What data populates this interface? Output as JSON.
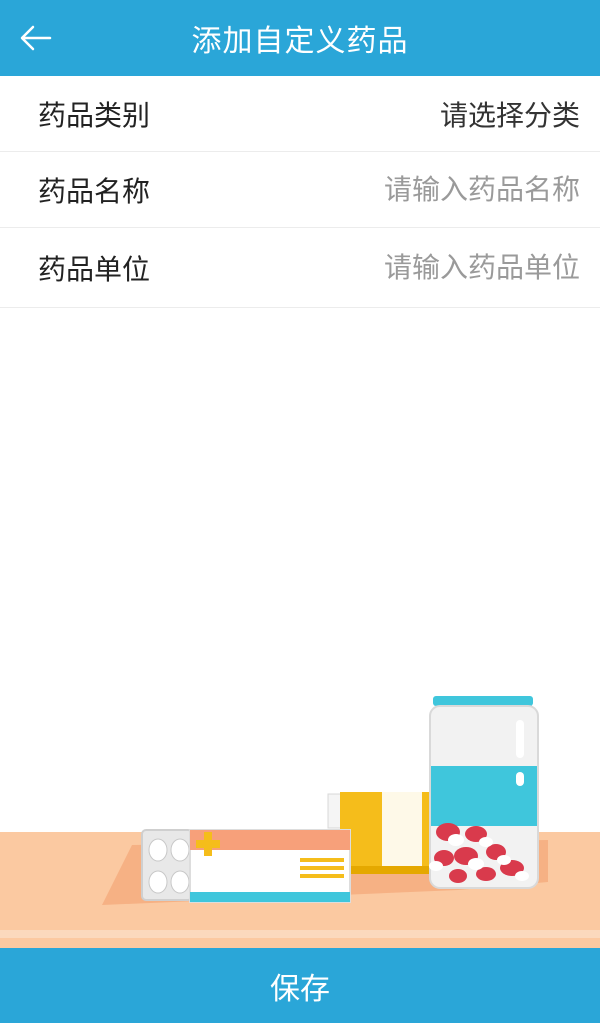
{
  "header": {
    "title": "添加自定义药品",
    "back_icon": "back-arrow-icon"
  },
  "form": {
    "category": {
      "label": "药品类别",
      "value": "请选择分类"
    },
    "name": {
      "label": "药品名称",
      "placeholder": "请输入药品名称",
      "value": ""
    },
    "unit": {
      "label": "药品单位",
      "placeholder": "请输入药品单位",
      "value": ""
    }
  },
  "footer": {
    "save_label": "保存"
  },
  "colors": {
    "primary": "#2aa6d8",
    "table": "#fbc9a1",
    "bottle_teal": "#3fc6dc",
    "box_orange": "#f7a07a",
    "box_yellow": "#f5bd1b",
    "pill_red": "#d93a4c"
  }
}
